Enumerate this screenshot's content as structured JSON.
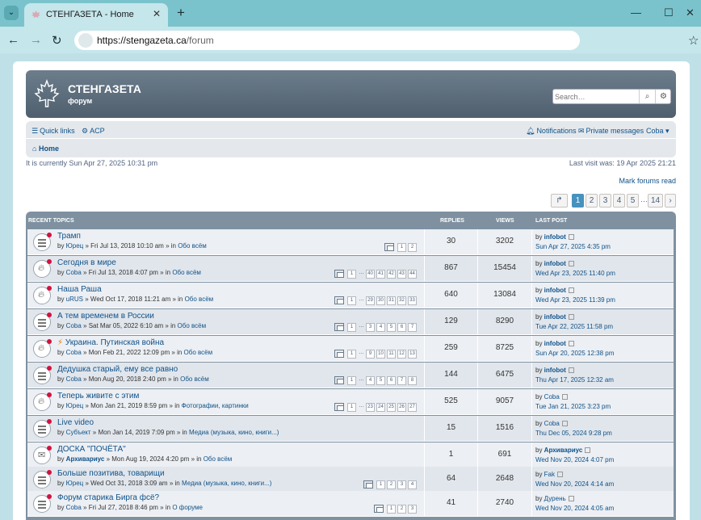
{
  "browser": {
    "tab_title": "СТЕНГАЗЕТА - Home",
    "url_host": "https://stengazeta.ca",
    "url_path": "/forum"
  },
  "site": {
    "title": "СТЕНГАЗЕТА",
    "subtitle": "форум",
    "search_placeholder": "Search…"
  },
  "nav": {
    "quick_links": "Quick links",
    "acp": "ACP",
    "notifications": "Notifications",
    "private_messages": "Private messages",
    "user": "Coba",
    "home": "Home"
  },
  "info": {
    "current_time": "It is currently Sun Apr 27, 2025 10:31 pm",
    "last_visit": "Last visit was: 19 Apr 2025 21:21",
    "mark_read": "Mark forums read"
  },
  "pagination": {
    "pages": [
      "1",
      "2",
      "3",
      "4",
      "5"
    ],
    "dots": "…",
    "last": "14",
    "active": "1"
  },
  "table": {
    "h_topics": "RECENT TOPICS",
    "h_replies": "REPLIES",
    "h_views": "VIEWS",
    "h_last": "LAST POST"
  },
  "topics": [
    {
      "title": "Трамп",
      "prefix": "by ",
      "author": "Юрец",
      "mid": " » Fri Jul 13, 2018 10:10 am » in ",
      "forum": "Обо всём",
      "pages": [
        "1",
        "2"
      ],
      "replies": "30",
      "views": "3202",
      "lp_user": "infobot",
      "lp_date": "Sun Apr 27, 2025 4:35 pm"
    },
    {
      "title": "Сегодня в мире",
      "prefix": "by ",
      "author": "Coba",
      "mid": " » Fri Jul 13, 2018 4:07 pm » in ",
      "forum": "Обо всём",
      "pages": [
        "1",
        "…",
        "40",
        "41",
        "42",
        "43",
        "44"
      ],
      "replies": "867",
      "views": "15454",
      "lp_user": "infobot",
      "lp_date": "Wed Apr 23, 2025 11:40 pm"
    },
    {
      "title": "Наша Раша",
      "prefix": "by ",
      "author": "uRUS",
      "mid": " » Wed Oct 17, 2018 11:21 am » in ",
      "forum": "Обо всём",
      "pages": [
        "1",
        "…",
        "29",
        "30",
        "31",
        "32",
        "33"
      ],
      "replies": "640",
      "views": "13084",
      "lp_user": "infobot",
      "lp_date": "Wed Apr 23, 2025 11:39 pm"
    },
    {
      "title": "А тем временем в России",
      "prefix": "by ",
      "author": "Coba",
      "mid": " » Sat Mar 05, 2022 6:10 am » in ",
      "forum": "Обо всём",
      "pages": [
        "1",
        "…",
        "3",
        "4",
        "5",
        "6",
        "7"
      ],
      "replies": "129",
      "views": "8290",
      "lp_user": "infobot",
      "lp_date": "Tue Apr 22, 2025 11:58 pm"
    },
    {
      "title": "Украина. Путинская война",
      "prefix": "by ",
      "author": "Coba",
      "mid": " » Mon Feb 21, 2022 12:09 pm » in ",
      "forum": "Обо всём",
      "pages": [
        "1",
        "…",
        "9",
        "10",
        "11",
        "12",
        "13"
      ],
      "replies": "259",
      "views": "8725",
      "lp_user": "infobot",
      "lp_date": "Sun Apr 20, 2025 12:38 pm"
    },
    {
      "title": "Дедушка старый, ему все равно",
      "prefix": "by ",
      "author": "Coba",
      "mid": " » Mon Aug 20, 2018 2:40 pm » in ",
      "forum": "Обо всём",
      "pages": [
        "1",
        "…",
        "4",
        "5",
        "6",
        "7",
        "8"
      ],
      "replies": "144",
      "views": "6475",
      "lp_user": "infobot",
      "lp_date": "Thu Apr 17, 2025 12:32 am"
    },
    {
      "title": "Теперь живите с этим",
      "prefix": "by ",
      "author": "Юрец",
      "mid": " » Mon Jan 21, 2019 8:59 pm » in ",
      "forum": "Фотографии, картинки",
      "pages": [
        "1",
        "…",
        "23",
        "24",
        "25",
        "26",
        "27"
      ],
      "replies": "525",
      "views": "9057",
      "lp_user": "Coba",
      "lp_date": "Tue Jan 21, 2025 3:23 pm"
    },
    {
      "title": "Live video",
      "prefix": "by ",
      "author": "Субъект",
      "mid": " » Mon Jan 14, 2019 7:09 pm » in ",
      "forum": "Медиа (музыка, кино, книги...)",
      "pages": [],
      "replies": "15",
      "views": "1516",
      "lp_user": "Coba",
      "lp_date": "Thu Dec 05, 2024 9:28 pm"
    },
    {
      "title": "ДОСКА \"ПОЧЁТА\"",
      "prefix": "by ",
      "author": "Архивариус",
      "mid": " » Mon Aug 19, 2024 4:20 pm » in ",
      "forum": "Обо всём",
      "pages": [],
      "replies": "1",
      "views": "691",
      "lp_user": "Архивариус",
      "lp_date": "Wed Nov 20, 2024 4:07 pm"
    },
    {
      "title": "Больше позитива, товарищи",
      "prefix": "by ",
      "author": "Юрец",
      "mid": " » Wed Oct 31, 2018 3:09 am » in ",
      "forum": "Медиа (музыка, кино, книги...)",
      "pages": [
        "1",
        "2",
        "3",
        "4"
      ],
      "replies": "64",
      "views": "2648",
      "lp_user": "Fak",
      "lp_date": "Wed Nov 20, 2024 4:14 am"
    },
    {
      "title": "Форум старика Бирга фсё?",
      "prefix": "by ",
      "author": "Coba",
      "mid": " » Fri Jul 27, 2018 8:46 pm » in ",
      "forum": "О форуме",
      "pages": [
        "1",
        "2",
        "3"
      ],
      "replies": "41",
      "views": "2740",
      "lp_user": "Дурень",
      "lp_date": "Wed Nov 20, 2024 4:05 am"
    }
  ],
  "colors": {
    "link": "#105289",
    "header_bg": "#5d6e7e",
    "table_bg": "#7f91a1",
    "unread_dot": "#d31141",
    "active_page": "#4692bf"
  }
}
